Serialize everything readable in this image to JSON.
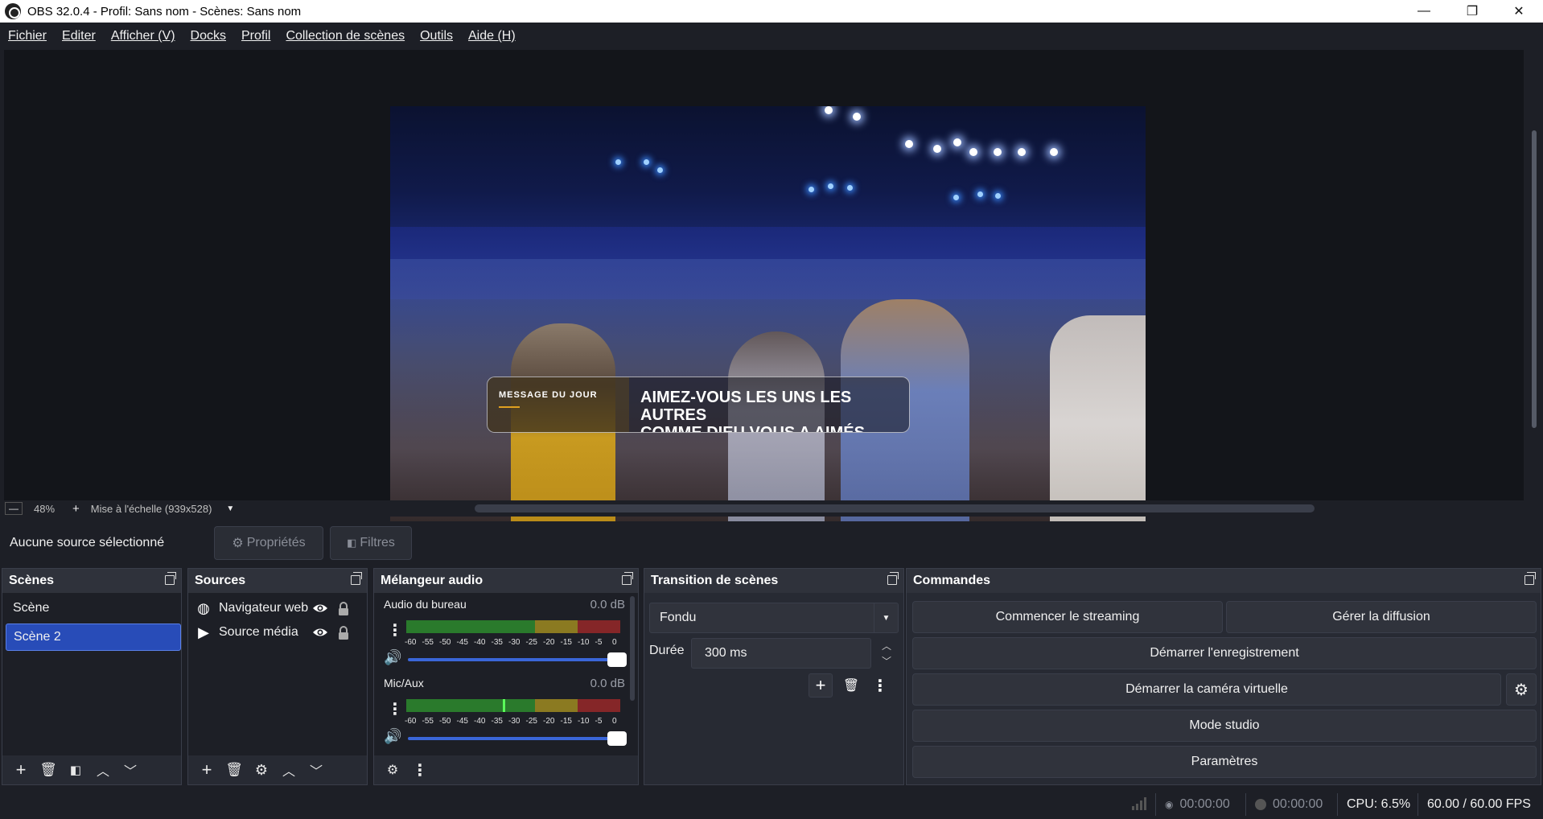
{
  "window": {
    "title": "OBS 32.0.4 - Profil: Sans nom - Scènes: Sans nom",
    "minimize": "—",
    "restore": "❐",
    "close": "✕"
  },
  "menu": [
    {
      "label": "Fichier"
    },
    {
      "label": "Editer"
    },
    {
      "label": "Afficher (V)"
    },
    {
      "label": "Docks"
    },
    {
      "label": "Profil"
    },
    {
      "label": "Collection de scènes"
    },
    {
      "label": "Outils"
    },
    {
      "label": "Aide (H)"
    }
  ],
  "preview": {
    "overlay_tag": "MESSAGE DU JOUR",
    "overlay_line1": "AIMEZ-VOUS LES UNS LES AUTRES",
    "overlay_line2": "COMME DIEU VOUS A AIMÉS"
  },
  "zoombar": {
    "zoom": "48%",
    "scale_mode": "Mise à l'échelle (939x528)"
  },
  "context": {
    "no_selection": "Aucune source sélectionné",
    "properties": "Propriétés",
    "filters": "Filtres"
  },
  "scenes": {
    "title": "Scènes",
    "items": [
      {
        "label": "Scène",
        "selected": false
      },
      {
        "label": "Scène 2",
        "selected": true
      }
    ]
  },
  "sources": {
    "title": "Sources",
    "items": [
      {
        "label": "Navigateur web",
        "icon": "globe-icon"
      },
      {
        "label": "Source média",
        "icon": "play-icon"
      }
    ]
  },
  "mixer": {
    "title": "Mélangeur audio",
    "channels": [
      {
        "name": "Audio du bureau",
        "db": "0.0 dB",
        "level": 0,
        "volume": 1.0
      },
      {
        "name": "Mic/Aux",
        "db": "0.0 dB",
        "level": 0.45,
        "volume": 1.0
      }
    ],
    "ticks": [
      "-60",
      "-55",
      "-50",
      "-45",
      "-40",
      "-35",
      "-30",
      "-25",
      "-20",
      "-15",
      "-10",
      "-5",
      "0"
    ]
  },
  "transition": {
    "title": "Transition de scènes",
    "type": "Fondu",
    "duration_label": "Durée",
    "duration": "300 ms"
  },
  "controls": {
    "title": "Commandes",
    "start_streaming": "Commencer le streaming",
    "manage_broadcast": "Gérer la diffusion",
    "start_recording": "Démarrer l'enregistrement",
    "start_virtualcam": "Démarrer la caméra virtuelle",
    "studio_mode": "Mode studio",
    "settings": "Paramètres"
  },
  "status": {
    "stream_time": "00:00:00",
    "record_time": "00:00:00",
    "cpu": "CPU: 6.5%",
    "fps": "60.00 / 60.00 FPS"
  },
  "colors": {
    "background": "#1d1f26",
    "dock": "#272a33",
    "selection": "#284cb8",
    "meter_green": "#2f9a2f",
    "meter_yellow": "#b09a20",
    "meter_red": "#a82a2a"
  }
}
